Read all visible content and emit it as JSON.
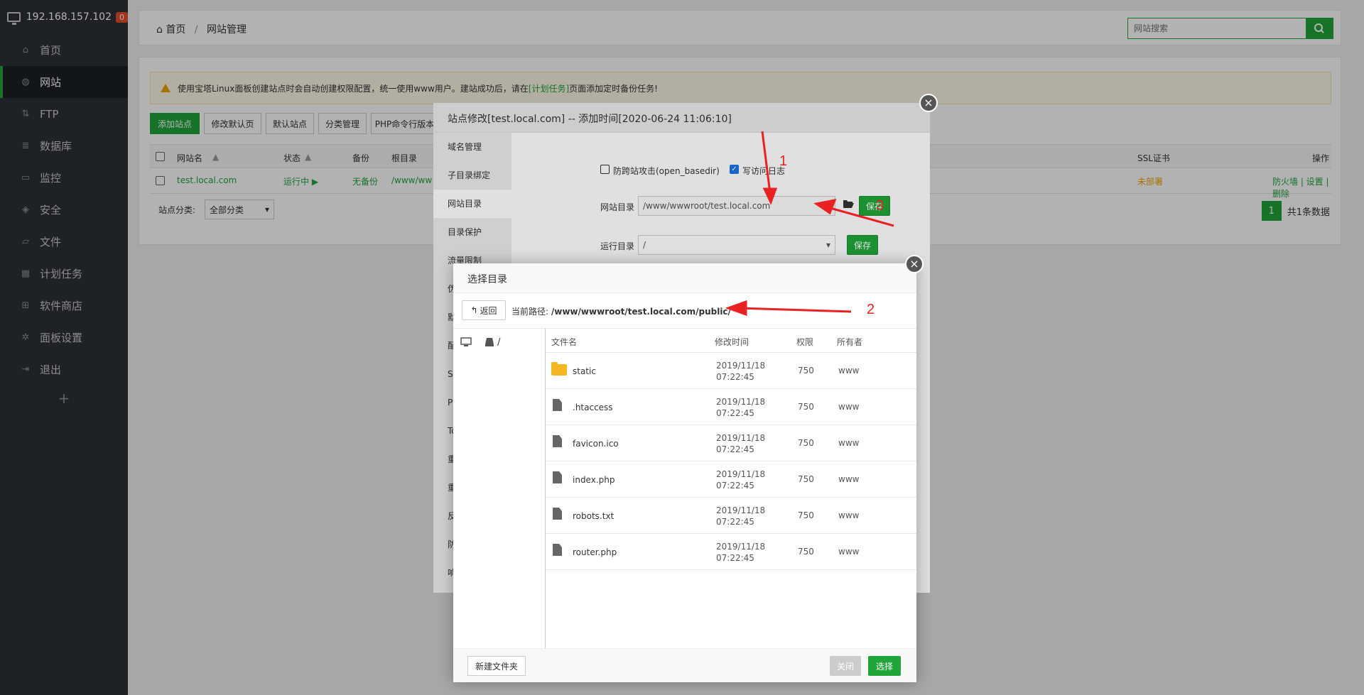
{
  "sidebar": {
    "host": "192.168.157.102",
    "badge": "0",
    "items": [
      {
        "label": "首页",
        "icon": "home-icon"
      },
      {
        "label": "网站",
        "icon": "globe-icon"
      },
      {
        "label": "FTP",
        "icon": "ftp-icon"
      },
      {
        "label": "数据库",
        "icon": "database-icon"
      },
      {
        "label": "监控",
        "icon": "monitor-icon"
      },
      {
        "label": "安全",
        "icon": "shield-icon"
      },
      {
        "label": "文件",
        "icon": "folder-icon"
      },
      {
        "label": "计划任务",
        "icon": "calendar-icon"
      },
      {
        "label": "软件商店",
        "icon": "apps-icon"
      },
      {
        "label": "面板设置",
        "icon": "gear-icon"
      },
      {
        "label": "退出",
        "icon": "logout-icon"
      }
    ],
    "active_index": 1,
    "add_label": "+"
  },
  "breadcrumb": {
    "home": "首页",
    "sep": "/",
    "current": "网站管理"
  },
  "search": {
    "placeholder": "网站搜索"
  },
  "notice": {
    "text_before": "使用宝塔Linux面板创建站点时会自动创建权限配置，统一使用www用户。建站成功后，请在",
    "link": "[计划任务]",
    "text_after": "页面添加定时备份任务!"
  },
  "toolbar": {
    "add_site": "添加站点",
    "modify_default": "修改默认页",
    "default_site": "默认站点",
    "category": "分类管理",
    "php_version": "PHP命令行版本"
  },
  "table": {
    "headers": {
      "name": "网站名",
      "status": "状态",
      "backup": "备份",
      "root": "根目录",
      "ssl": "SSL证书",
      "actions": "操作"
    },
    "row": {
      "name": "test.local.com",
      "status": "运行中 ▶",
      "backup": "无备份",
      "root": "/www/ww",
      "ssl": "未部署",
      "actions": "防火墙 | 设置 | 删除"
    }
  },
  "category_filter": {
    "label": "站点分类:",
    "value": "全部分类"
  },
  "pagination": {
    "page": "1",
    "total": "共1条数据"
  },
  "modal_site": {
    "title": "站点修改[test.local.com] -- 添加时间[2020-06-24 11:06:10]",
    "menu": [
      "域名管理",
      "子目录绑定",
      "网站目录",
      "目录保护",
      "流量限制",
      "伪",
      "默",
      "配",
      "SS",
      "PH",
      "To",
      "重",
      "重",
      "反",
      "防",
      "响"
    ],
    "active_menu": 2,
    "anti_xss": "防跨站攻击(open_basedir)",
    "log": "写访问日志",
    "site_dir_label": "网站目录",
    "site_dir_value": "/www/wwwroot/test.local.com",
    "run_dir_label": "运行目录",
    "run_dir_value": "/",
    "save": "保存"
  },
  "modal_dir": {
    "title": "选择目录",
    "back": "返回",
    "path_label": "当前路径:",
    "path": "/www/wwwroot/test.local.com/public/",
    "tree_root": "/",
    "headers": {
      "name": "文件名",
      "mtime": "修改时间",
      "perm": "权限",
      "owner": "所有者"
    },
    "files": [
      {
        "name": "static",
        "type": "folder",
        "date": "2019/11/18",
        "time": "07:22:45",
        "perm": "750",
        "owner": "www"
      },
      {
        "name": ".htaccess",
        "type": "file",
        "date": "2019/11/18",
        "time": "07:22:45",
        "perm": "750",
        "owner": "www"
      },
      {
        "name": "favicon.ico",
        "type": "file",
        "date": "2019/11/18",
        "time": "07:22:45",
        "perm": "750",
        "owner": "www"
      },
      {
        "name": "index.php",
        "type": "file",
        "date": "2019/11/18",
        "time": "07:22:45",
        "perm": "750",
        "owner": "www"
      },
      {
        "name": "robots.txt",
        "type": "file",
        "date": "2019/11/18",
        "time": "07:22:45",
        "perm": "750",
        "owner": "www"
      },
      {
        "name": "router.php",
        "type": "file",
        "date": "2019/11/18",
        "time": "07:22:45",
        "perm": "750",
        "owner": "www"
      }
    ],
    "new_folder": "新建文件夹",
    "close": "关闭",
    "select": "选择"
  },
  "annotations": {
    "a1": "1",
    "a2": "2",
    "a3": "3"
  },
  "colors": {
    "accent": "#20a53a",
    "arrow": "#e82222",
    "sidebar": "#2b3035"
  }
}
